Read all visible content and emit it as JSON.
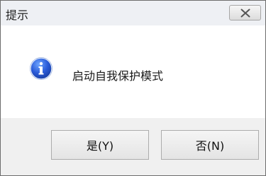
{
  "window": {
    "title": "提示",
    "close_icon": "close-icon"
  },
  "message": {
    "icon": "info-icon",
    "text": "启动自我保护模式"
  },
  "buttons": {
    "yes_label": "是(Y)",
    "no_label": "否(N)"
  }
}
